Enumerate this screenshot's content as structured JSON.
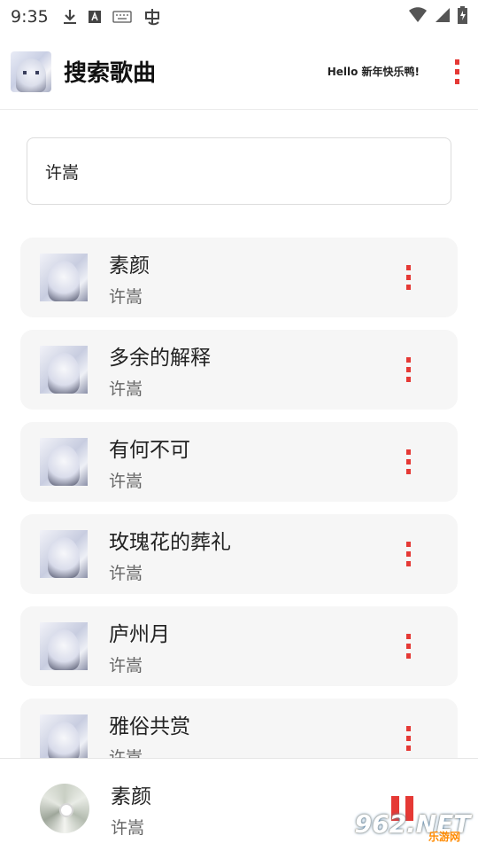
{
  "status_bar": {
    "time": "9:35",
    "left_icons": [
      "download-icon",
      "keyboard-a-icon",
      "keyboard-icon",
      "app-icon"
    ],
    "right_icons": [
      "wifi-icon",
      "signal-icon",
      "battery-icon"
    ]
  },
  "header": {
    "title": "搜索歌曲",
    "greeting": "Hello 新年快乐鸭!"
  },
  "search": {
    "value": "许嵩"
  },
  "songs": [
    {
      "title": "素颜",
      "artist": "许嵩"
    },
    {
      "title": "多余的解释",
      "artist": "许嵩"
    },
    {
      "title": "有何不可",
      "artist": "许嵩"
    },
    {
      "title": "玫瑰花的葬礼",
      "artist": "许嵩"
    },
    {
      "title": "庐州月",
      "artist": "许嵩"
    },
    {
      "title": "雅俗共赏",
      "artist": "许嵩"
    }
  ],
  "player": {
    "title": "素颜",
    "artist": "许嵩"
  },
  "watermark": {
    "main": "962.NET",
    "sub": "乐游网"
  },
  "colors": {
    "accent": "#e53935",
    "card_bg": "#f6f6f6"
  }
}
